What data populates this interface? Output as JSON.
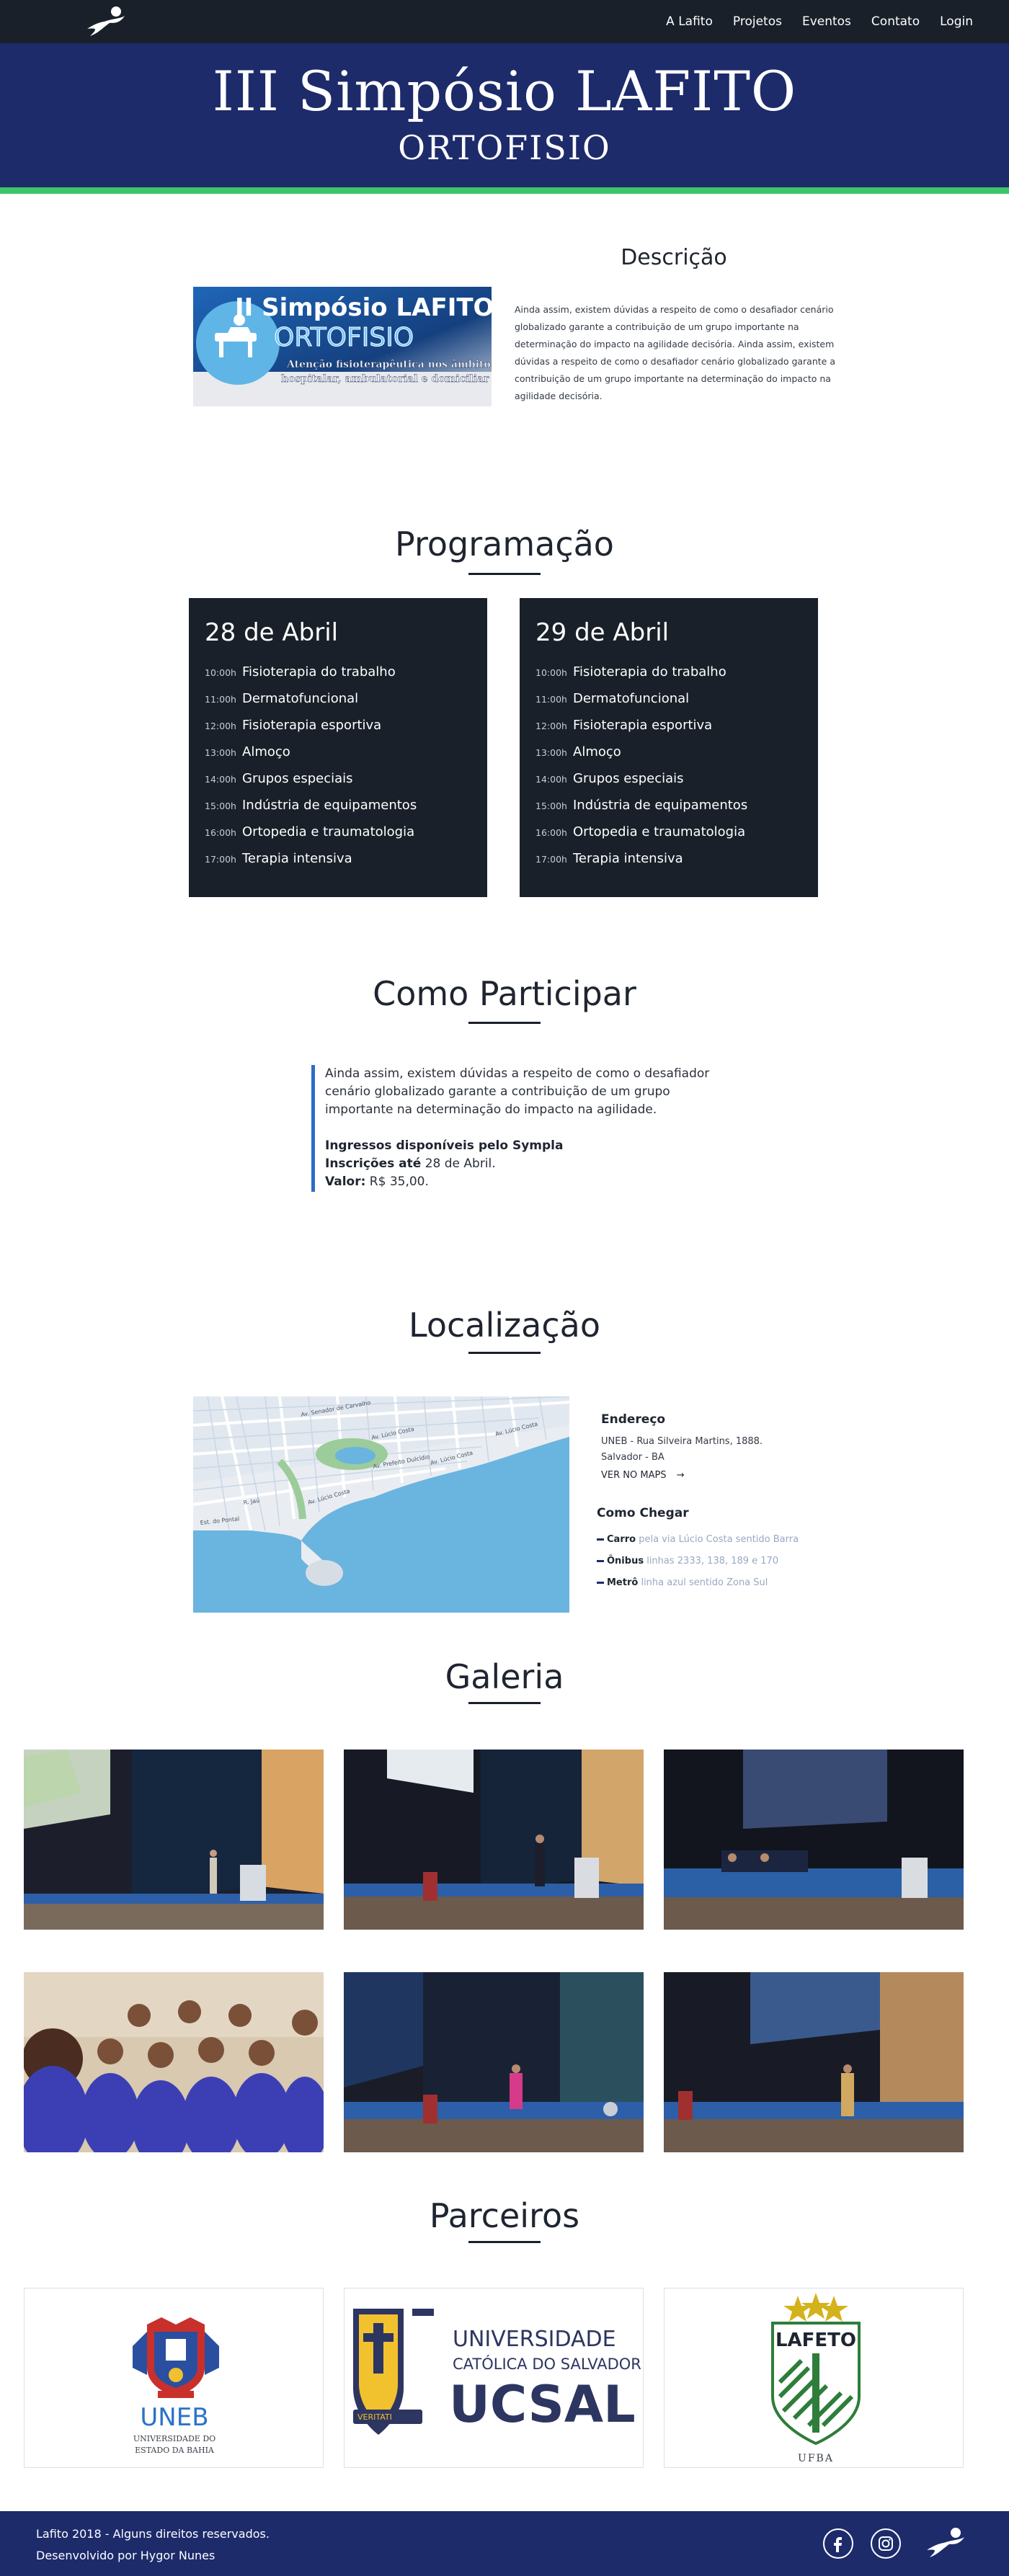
{
  "nav": {
    "items": [
      "A Lafito",
      "Projetos",
      "Eventos",
      "Contato",
      "Login"
    ]
  },
  "hero": {
    "title": "III Simpósio LAFITO",
    "subtitle": "ORTOFISIO"
  },
  "descricao": {
    "title": "Descrição",
    "banner_line1": "II Simpósio LAFITO",
    "banner_line2": "ORTOFISIO",
    "banner_line3": "Atenção fisioterapêutica nos âmbitos",
    "banner_line4": "hospitalar, ambulatorial e domiciliar",
    "text": "Ainda assim, existem dúvidas a respeito de como o desafiador cenário globalizado garante a contribuição de um grupo importante na determinação do impacto na agilidade decisória. Ainda assim, existem dúvidas a respeito de como o desafiador cenário globalizado garante a contribuição de um grupo importante na determinação do impacto na agilidade decisória."
  },
  "programacao": {
    "title": "Programação",
    "days": [
      {
        "title": "28 de Abril",
        "items": [
          {
            "time": "10:00h",
            "name": "Fisioterapia do trabalho"
          },
          {
            "time": "11:00h",
            "name": "Dermatofuncional"
          },
          {
            "time": "12:00h",
            "name": "Fisioterapia esportiva"
          },
          {
            "time": "13:00h",
            "name": "Almoço"
          },
          {
            "time": "14:00h",
            "name": "Grupos especiais"
          },
          {
            "time": "15:00h",
            "name": "Indústria de equipamentos"
          },
          {
            "time": "16:00h",
            "name": "Ortopedia e traumatologia"
          },
          {
            "time": "17:00h",
            "name": "Terapia intensiva"
          }
        ]
      },
      {
        "title": "29 de Abril",
        "items": [
          {
            "time": "10:00h",
            "name": "Fisioterapia do trabalho"
          },
          {
            "time": "11:00h",
            "name": "Dermatofuncional"
          },
          {
            "time": "12:00h",
            "name": "Fisioterapia esportiva"
          },
          {
            "time": "13:00h",
            "name": "Almoço"
          },
          {
            "time": "14:00h",
            "name": "Grupos especiais"
          },
          {
            "time": "15:00h",
            "name": "Indústria de equipamentos"
          },
          {
            "time": "16:00h",
            "name": "Ortopedia e traumatologia"
          },
          {
            "time": "17:00h",
            "name": "Terapia intensiva"
          }
        ]
      }
    ]
  },
  "participar": {
    "title": "Como Participar",
    "text": "Ainda assim, existem dúvidas a respeito de como o desafiador cenário globalizado garante a contribuição de um grupo importante na determinação do impacto na agilidade.",
    "ingressos": "Ingressos disponíveis pelo Sympla",
    "inscricoes_label": "Inscrições até",
    "inscricoes_value": "28 de Abril.",
    "valor_label": "Valor:",
    "valor_value": "R$ 35,00."
  },
  "localizacao": {
    "title": "Localização",
    "endereco_label": "Endereço",
    "endereco_line1": "UNEB - Rua Silveira Martins, 1888.",
    "endereco_line2": "Salvador - BA",
    "maps_link": "VER NO MAPS",
    "chegar_label": "Como Chegar",
    "chegar": [
      {
        "mode": "Carro",
        "detail": "pela via Lúcio Costa sentido Barra"
      },
      {
        "mode": "Ônibus",
        "detail": "linhas 2333, 138, 189 e 170"
      },
      {
        "mode": "Metrô",
        "detail": "linha azul sentido Zona Sul"
      }
    ],
    "map_labels": [
      "Av. Senador de Carvalho",
      "Av. Lúcio Costa",
      "Av. Lúcio Costa",
      "Av. Prefeito Dulcídio",
      "Av. Lúcio Costa",
      "Av. Lúcio Costa",
      "R. Jaú",
      "Est. do Pontal"
    ]
  },
  "galeria": {
    "title": "Galeria"
  },
  "parceiros": {
    "title": "Parceiros",
    "uneb_name": "UNEB",
    "uneb_sub1": "UNIVERSIDADE DO",
    "uneb_sub2": "ESTADO DA BAHIA",
    "ucsal_line1": "UNIVERSIDADE",
    "ucsal_line2": "CATÓLICA DO SALVADOR",
    "ucsal_name": "UCSAL",
    "ucsal_motto": "VERITATI",
    "lafeto_name": "LAFETO",
    "ufba_name": "UFBA"
  },
  "footer": {
    "line1": "Lafito 2018 - Alguns direitos reservados.",
    "line2": "Desenvolvido por Hygor Nunes"
  },
  "colors": {
    "nav_bg": "#192029",
    "hero_bg": "#1d2b6b",
    "accent_green": "#3ec56a",
    "card_bg": "#192029",
    "quote_border": "#2d6cc8"
  }
}
